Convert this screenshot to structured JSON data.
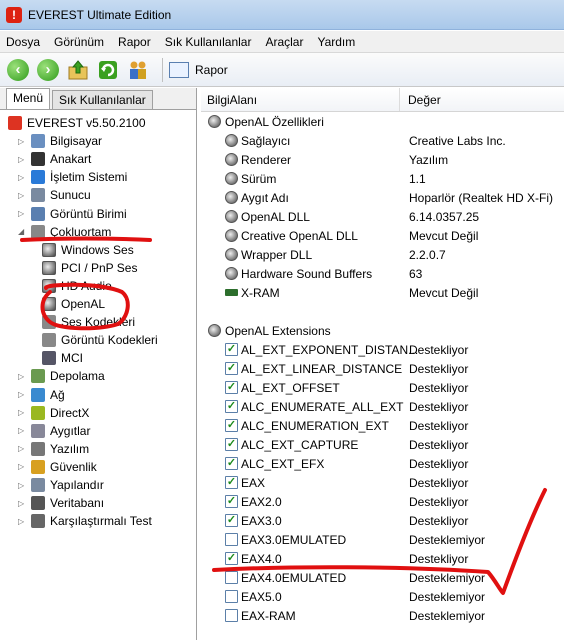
{
  "window": {
    "title": "EVEREST Ultimate Edition"
  },
  "menu": [
    "Dosya",
    "Görünüm",
    "Rapor",
    "Sık Kullanılanlar",
    "Araçlar",
    "Yardım"
  ],
  "toolbar": {
    "report_label": "Rapor"
  },
  "left": {
    "tabs": [
      "Menü",
      "Sık Kullanılanlar"
    ],
    "tree": [
      {
        "label": "EVEREST v5.50.2100",
        "depth": 0,
        "icon": "everest-icon",
        "color": "#d32"
      },
      {
        "label": "Bilgisayar",
        "depth": 1,
        "icon": "computer-icon",
        "color": "#6a8fc0"
      },
      {
        "label": "Anakart",
        "depth": 1,
        "icon": "motherboard-icon",
        "color": "#333"
      },
      {
        "label": "İşletim Sistemi",
        "depth": 1,
        "icon": "os-icon",
        "color": "#2a7ad8"
      },
      {
        "label": "Sunucu",
        "depth": 1,
        "icon": "server-icon",
        "color": "#7a8aa0"
      },
      {
        "label": "Görüntü Birimi",
        "depth": 1,
        "icon": "display-icon",
        "color": "#5a7fb0"
      },
      {
        "label": "Çokluortam",
        "depth": 1,
        "icon": "multimedia-icon",
        "color": "#888"
      },
      {
        "label": "Windows Ses",
        "depth": 2,
        "icon": "speaker-icon",
        "color": "#888"
      },
      {
        "label": "PCI / PnP Ses",
        "depth": 2,
        "icon": "speaker-icon",
        "color": "#888"
      },
      {
        "label": "HD Audio",
        "depth": 2,
        "icon": "speaker-icon",
        "color": "#888"
      },
      {
        "label": "OpenAL",
        "depth": 2,
        "icon": "speaker-icon",
        "color": "#888"
      },
      {
        "label": "Ses Kodekleri",
        "depth": 2,
        "icon": "codec-icon",
        "color": "#888"
      },
      {
        "label": "Görüntü Kodekleri",
        "depth": 2,
        "icon": "video-codec-icon",
        "color": "#888"
      },
      {
        "label": "MCI",
        "depth": 2,
        "icon": "mci-icon",
        "color": "#556"
      },
      {
        "label": "Depolama",
        "depth": 1,
        "icon": "storage-icon",
        "color": "#6a9a50"
      },
      {
        "label": "Ağ",
        "depth": 1,
        "icon": "network-icon",
        "color": "#3a8ad0"
      },
      {
        "label": "DirectX",
        "depth": 1,
        "icon": "directx-icon",
        "color": "#9ab820"
      },
      {
        "label": "Aygıtlar",
        "depth": 1,
        "icon": "devices-icon",
        "color": "#889"
      },
      {
        "label": "Yazılım",
        "depth": 1,
        "icon": "software-icon",
        "color": "#777"
      },
      {
        "label": "Güvenlik",
        "depth": 1,
        "icon": "shield-icon",
        "color": "#d8a020"
      },
      {
        "label": "Yapılandır",
        "depth": 1,
        "icon": "config-icon",
        "color": "#7a8aa0"
      },
      {
        "label": "Veritabanı",
        "depth": 1,
        "icon": "database-icon",
        "color": "#555"
      },
      {
        "label": "Karşılaştırmalı Test",
        "depth": 1,
        "icon": "benchmark-icon",
        "color": "#666"
      }
    ]
  },
  "right": {
    "columns": [
      "BilgiAlanı",
      "Değer"
    ],
    "section1": "OpenAL Özellikleri",
    "props": [
      {
        "field": "Sağlayıcı",
        "value": "Creative Labs Inc."
      },
      {
        "field": "Renderer",
        "value": "Yazılım"
      },
      {
        "field": "Sürüm",
        "value": "1.1"
      },
      {
        "field": "Aygıt Adı",
        "value": "Hoparlör (Realtek HD X-Fi)"
      },
      {
        "field": "OpenAL DLL",
        "value": "6.14.0357.25"
      },
      {
        "field": "Creative OpenAL DLL",
        "value": "Mevcut Değil"
      },
      {
        "field": "Wrapper DLL",
        "value": "2.2.0.7"
      },
      {
        "field": "Hardware Sound Buffers",
        "value": "63"
      },
      {
        "field": "X-RAM",
        "value": "Mevcut Değil"
      }
    ],
    "section2": "OpenAL Extensions",
    "extensions": [
      {
        "field": "AL_EXT_EXPONENT_DISTAN...",
        "value": "Destekliyor",
        "on": true
      },
      {
        "field": "AL_EXT_LINEAR_DISTANCE",
        "value": "Destekliyor",
        "on": true
      },
      {
        "field": "AL_EXT_OFFSET",
        "value": "Destekliyor",
        "on": true
      },
      {
        "field": "ALC_ENUMERATE_ALL_EXT",
        "value": "Destekliyor",
        "on": true
      },
      {
        "field": "ALC_ENUMERATION_EXT",
        "value": "Destekliyor",
        "on": true
      },
      {
        "field": "ALC_EXT_CAPTURE",
        "value": "Destekliyor",
        "on": true
      },
      {
        "field": "ALC_EXT_EFX",
        "value": "Destekliyor",
        "on": true
      },
      {
        "field": "EAX",
        "value": "Destekliyor",
        "on": true
      },
      {
        "field": "EAX2.0",
        "value": "Destekliyor",
        "on": true
      },
      {
        "field": "EAX3.0",
        "value": "Destekliyor",
        "on": true
      },
      {
        "field": "EAX3.0EMULATED",
        "value": "Desteklemiyor",
        "on": false
      },
      {
        "field": "EAX4.0",
        "value": "Destekliyor",
        "on": true
      },
      {
        "field": "EAX4.0EMULATED",
        "value": "Desteklemiyor",
        "on": false
      },
      {
        "field": "EAX5.0",
        "value": "Desteklemiyor",
        "on": false
      },
      {
        "field": "EAX-RAM",
        "value": "Desteklemiyor",
        "on": false
      }
    ]
  },
  "annotation_color": "#e01010"
}
